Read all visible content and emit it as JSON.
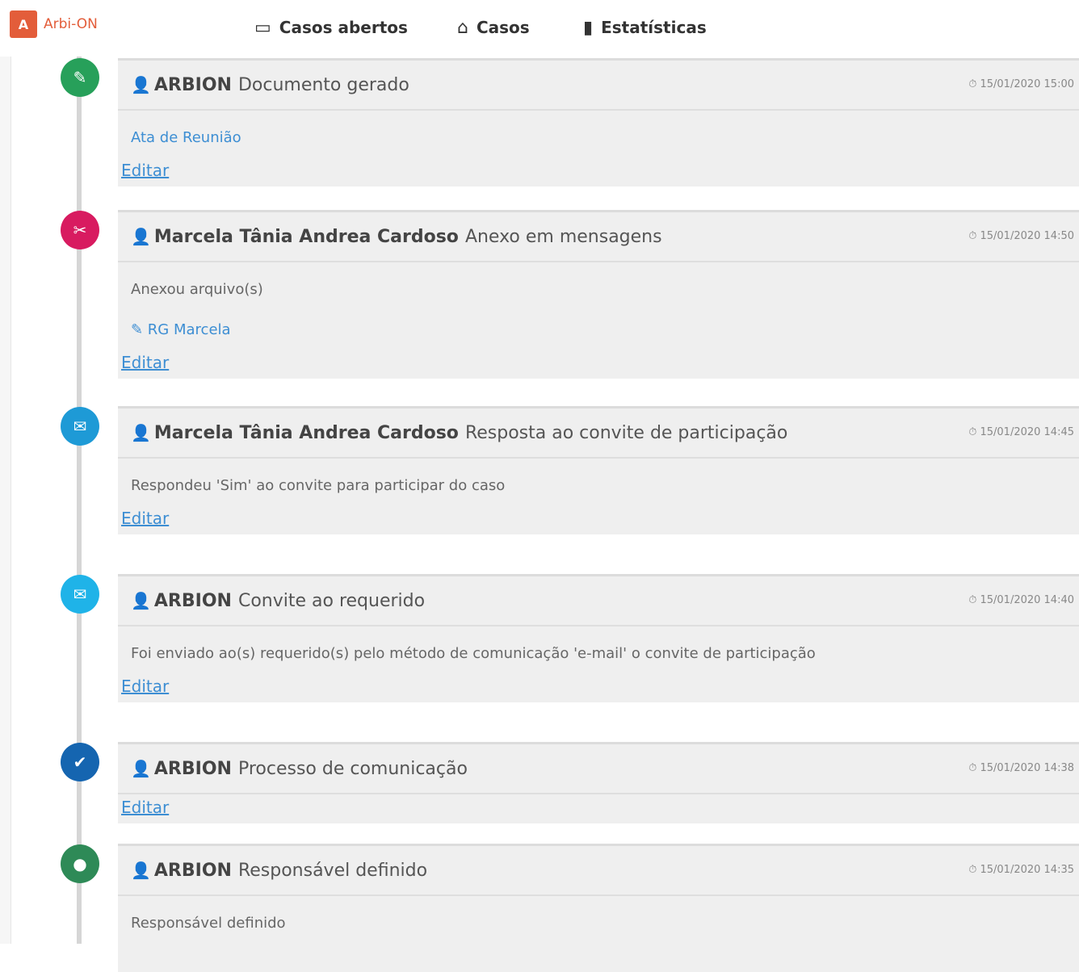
{
  "brand": {
    "logo_text": "A",
    "name": "Arbi-ON"
  },
  "nav": [
    {
      "icon": "▭",
      "label": "Casos abertos"
    },
    {
      "icon": "⌂",
      "label": "Casos"
    },
    {
      "icon": "▮",
      "label": "Estatísticas"
    }
  ],
  "timeline": [
    {
      "icon_color": "#27a05a",
      "icon": "✎",
      "user": "ARBION",
      "action": "Documento gerado",
      "timestamp": "⏱ 15/01/2020 15:00",
      "lines": [
        {
          "text": "Ata de Reunião",
          "link": true
        }
      ],
      "edit": "Editar"
    },
    {
      "icon_color": "#d81b60",
      "icon": "✂",
      "user": "Marcela Tânia Andrea Cardoso",
      "action": "Anexo em mensagens",
      "timestamp": "⏱ 15/01/2020 14:50",
      "lines": [
        {
          "text": "Anexou arquivo(s)",
          "link": false
        },
        {
          "text": "✎ RG Marcela",
          "link": true
        }
      ],
      "edit": "Editar"
    },
    {
      "icon_color": "#1e9ad6",
      "icon": "✉",
      "user": "Marcela Tânia Andrea Cardoso",
      "action": "Resposta ao convite de participação",
      "timestamp": "⏱ 15/01/2020 14:45",
      "lines": [
        {
          "text": "Respondeu 'Sim' ao convite para participar do caso",
          "link": false
        }
      ],
      "edit": "Editar"
    },
    {
      "icon_color": "#1fb3e8",
      "icon": "✉",
      "user": "ARBION",
      "action": "Convite ao requerido",
      "timestamp": "⏱ 15/01/2020 14:40",
      "lines": [
        {
          "text": "Foi enviado ao(s) requerido(s) pelo método de comunicação 'e-mail' o convite de participação",
          "link": false
        }
      ],
      "edit": "Editar"
    },
    {
      "icon_color": "#1565b0",
      "icon": "✔",
      "user": "ARBION",
      "action": "Processo de comunicação",
      "timestamp": "⏱ 15/01/2020 14:38",
      "lines": [],
      "edit": "Editar"
    },
    {
      "icon_color": "#2e8a57",
      "icon": "●",
      "user": "ARBION",
      "action": "Responsável definido",
      "timestamp": "⏱ 15/01/2020 14:35",
      "lines": [
        {
          "text": "Responsável definido",
          "link": false
        }
      ],
      "edit": ""
    }
  ]
}
